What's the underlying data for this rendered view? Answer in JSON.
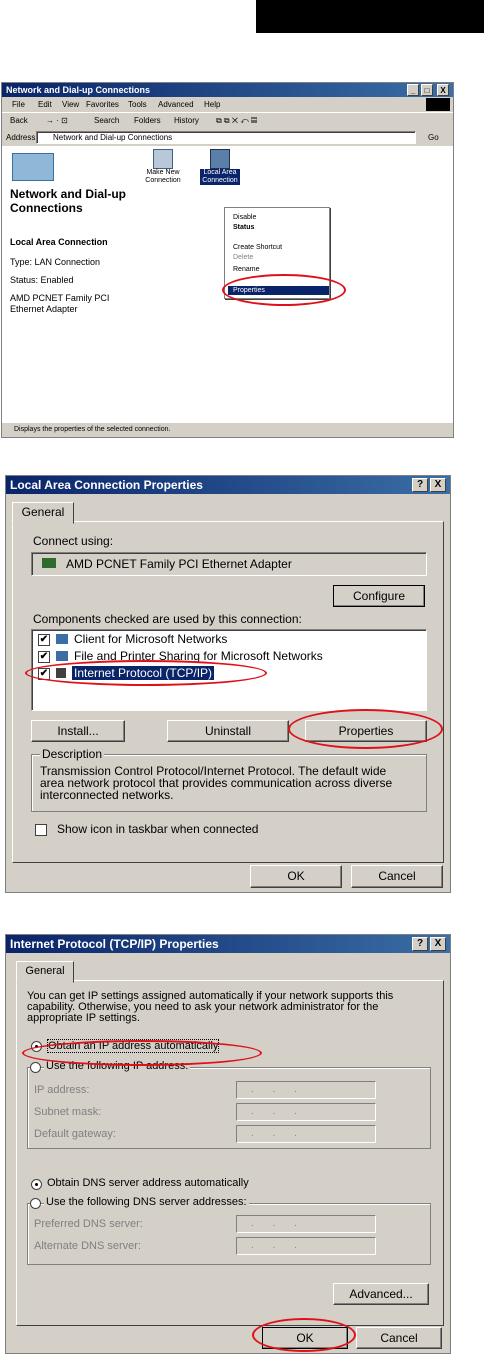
{
  "explorer": {
    "title": "Network and Dial-up Connections",
    "menu": [
      "File",
      "Edit",
      "View",
      "Favorites",
      "Tools",
      "Advanced",
      "Help"
    ],
    "toolbar": [
      "Back",
      "Search",
      "Folders",
      "History"
    ],
    "address_label": "Address",
    "address_value": "Network and Dial-up Connections",
    "go_label": "Go",
    "sidebar_title": "Network and Dial-up Connections",
    "sidebar_conn_name": "Local Area Connection",
    "sidebar_type": "Type: LAN Connection",
    "sidebar_status": "Status: Enabled",
    "sidebar_adapter": "AMD PCNET Family PCI Ethernet Adapter",
    "icons": [
      "Make New Connection",
      "Local Area Connection"
    ],
    "context_menu": [
      "Disable",
      "Status",
      "Create Shortcut",
      "Delete",
      "Rename",
      "Properties"
    ],
    "statusbar": "Displays the properties of the selected connection."
  },
  "lac": {
    "title": "Local Area Connection Properties",
    "tab": "General",
    "connect_using": "Connect using:",
    "adapter": "AMD PCNET Family PCI Ethernet Adapter",
    "configure": "Configure",
    "components_label": "Components checked are used by this connection:",
    "components": [
      "Client for Microsoft Networks",
      "File and Printer Sharing for Microsoft Networks",
      "Internet Protocol (TCP/IP)"
    ],
    "install": "Install...",
    "uninstall": "Uninstall",
    "properties": "Properties",
    "description_label": "Description",
    "description": "Transmission Control Protocol/Internet Protocol. The default wide area network protocol that provides communication across diverse interconnected networks.",
    "show_icon": "Show icon in taskbar when connected",
    "ok": "OK",
    "cancel": "Cancel"
  },
  "tcp": {
    "title": "Internet Protocol (TCP/IP) Properties",
    "tab": "General",
    "intro": "You can get IP settings assigned automatically if your network supports this capability. Otherwise, you need to ask your network administrator for the appropriate IP settings.",
    "obtain_ip": "Obtain an IP address automatically",
    "use_ip": "Use the following IP address:",
    "ip_address": "IP address:",
    "subnet_mask": "Subnet mask:",
    "default_gateway": "Default gateway:",
    "obtain_dns": "Obtain DNS server address automatically",
    "use_dns": "Use the following DNS server addresses:",
    "preferred_dns": "Preferred DNS server:",
    "alternate_dns": "Alternate DNS server:",
    "ip_placeholder": ". . .",
    "advanced": "Advanced...",
    "ok": "OK",
    "cancel": "Cancel"
  },
  "help_label": "?",
  "close_label": "X"
}
